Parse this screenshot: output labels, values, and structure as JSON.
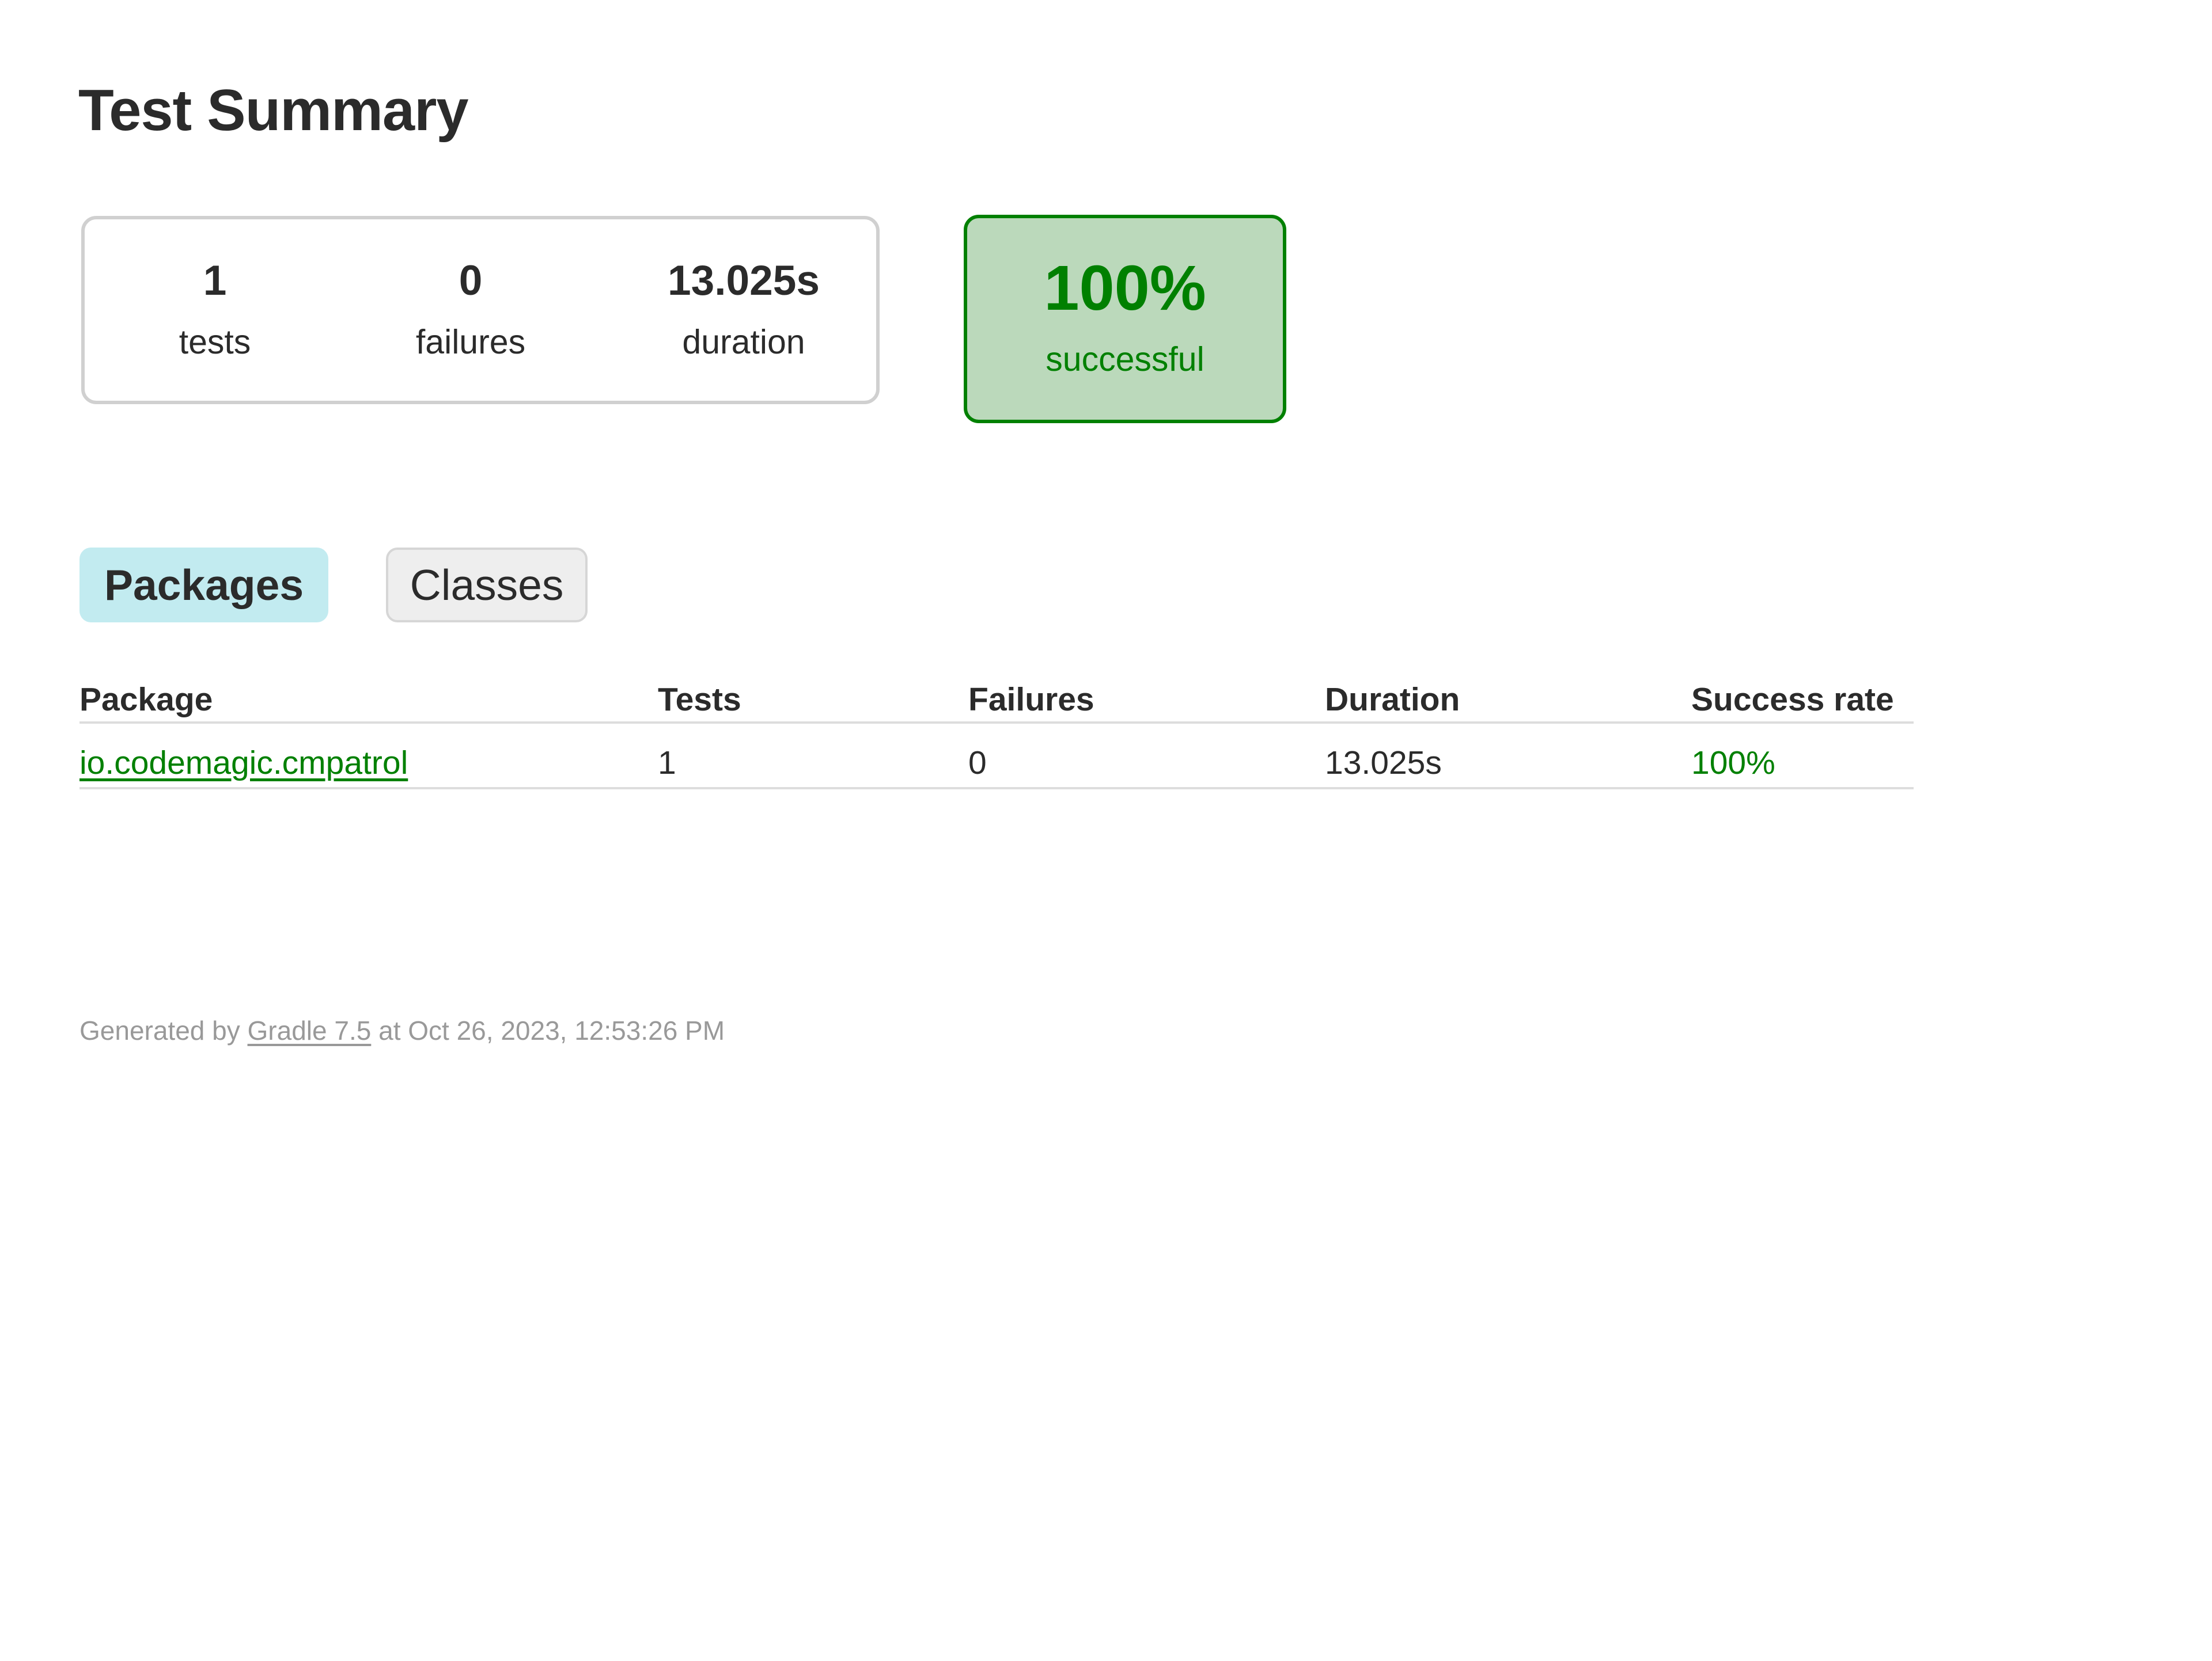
{
  "page": {
    "title": "Test Summary"
  },
  "summary": {
    "tests": {
      "value": "1",
      "label": "tests"
    },
    "failures": {
      "value": "0",
      "label": "failures"
    },
    "duration": {
      "value": "13.025s",
      "label": "duration"
    },
    "success": {
      "value": "100%",
      "label": "successful"
    }
  },
  "tabs": [
    {
      "label": "Packages",
      "selected": true
    },
    {
      "label": "Classes",
      "selected": false
    }
  ],
  "table": {
    "headers": [
      "Package",
      "Tests",
      "Failures",
      "Duration",
      "Success rate"
    ],
    "rows": [
      {
        "package": "io.codemagic.cmpatrol",
        "tests": "1",
        "failures": "0",
        "duration": "13.025s",
        "success_rate": "100%"
      }
    ]
  },
  "footer": {
    "prefix": "Generated by ",
    "link_text": "Gradle 7.5",
    "suffix": " at Oct 26, 2023, 12:53:26 PM"
  },
  "colors": {
    "success": "#008000",
    "success_bg": "#bbd9bb",
    "selected_tab_bg": "#c2ebf0",
    "tab_bg": "#eeeeee",
    "muted_text": "#999999"
  }
}
